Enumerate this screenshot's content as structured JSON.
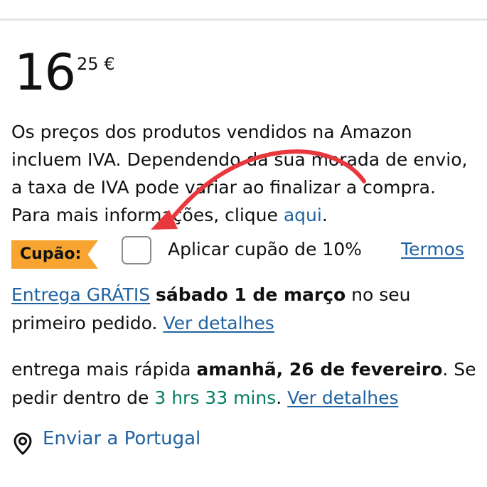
{
  "price": {
    "whole": "16",
    "fraction": "25",
    "currency": "€"
  },
  "vat_notice": {
    "line1": "Os preços dos produtos vendidos na Amazon",
    "line2": "incluem IVA. Dependendo da sua morada de envio,",
    "line3": "a taxa de IVA pode variar ao finalizar a compra.",
    "line4_prefix": "Para mais informações, clique ",
    "link": "aqui",
    "line4_suffix": "."
  },
  "coupon": {
    "badge": "Cupão:",
    "apply_label": "Aplicar cupão de 10%",
    "terms_link": "Termos",
    "checked": false
  },
  "delivery": {
    "free_link": "Entrega GRÁTIS",
    "date": "sábado 1 de março",
    "suffix_line1": " no seu",
    "line2_prefix": "primeiro pedido. ",
    "details_link": "Ver detalhes"
  },
  "fast_delivery": {
    "prefix": "entrega mais rápida ",
    "date": "amanhã, 26 de fevereiro",
    "suffix": ". Se",
    "line2_prefix": "pedir dentro de ",
    "countdown": "3 hrs 33 mins",
    "line2_mid": ". ",
    "details_link": "Ver detalhes"
  },
  "shipping": {
    "label": "Enviar a Portugal",
    "icon": "location-pin-icon"
  },
  "colors": {
    "link": "#2162a1",
    "coupon_badge": "#f7a530",
    "countdown": "#067d62",
    "annotation_arrow": "#e8383d"
  }
}
